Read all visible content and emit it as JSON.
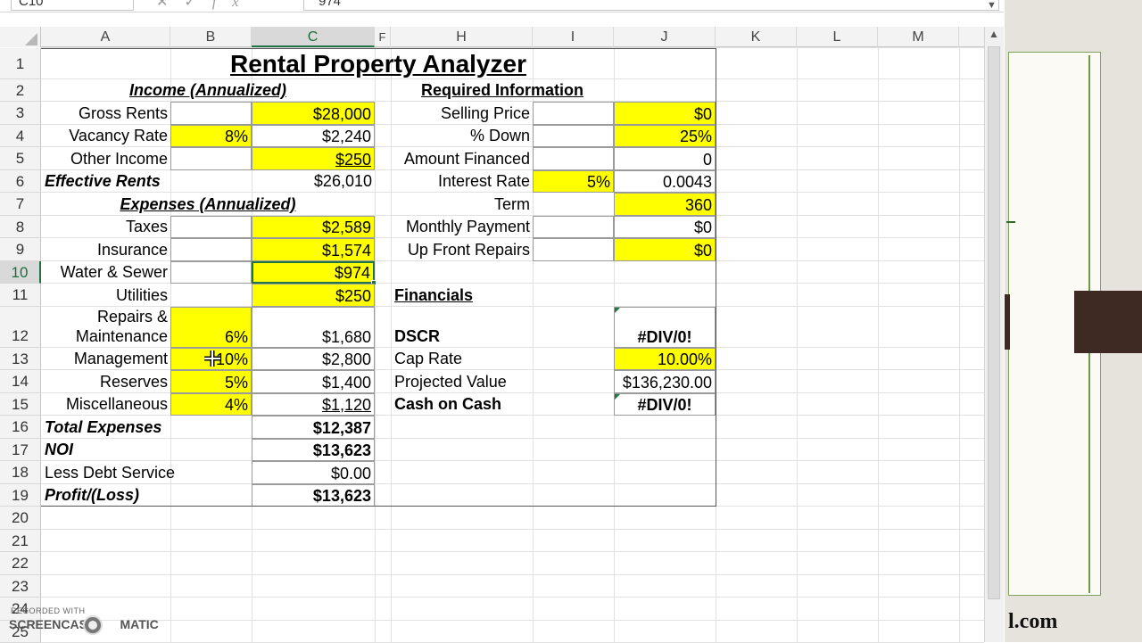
{
  "formula_bar": {
    "name_box": "C10",
    "icons": [
      "cancel-icon",
      "enter-icon",
      "function-icon"
    ],
    "formula": "974"
  },
  "columns": [
    "A",
    "B",
    "C",
    "F",
    "H",
    "I",
    "J",
    "K",
    "L",
    "M"
  ],
  "selected_column": "C",
  "rows": [
    "1",
    "2",
    "3",
    "4",
    "5",
    "6",
    "7",
    "8",
    "9",
    "10",
    "11",
    "12",
    "13",
    "14",
    "15",
    "16",
    "17",
    "18",
    "19",
    "20",
    "21",
    "22",
    "23",
    "24",
    "25"
  ],
  "selected_row": "10",
  "sheet": {
    "title": "Rental Property Analyzer",
    "income_header": "Income (Annualized)",
    "required_header": "Required Information",
    "gross_rents": {
      "label": "Gross Rents",
      "value": "$28,000"
    },
    "vacancy_rate": {
      "label": "Vacancy Rate",
      "pct": "8%",
      "value": "$2,240"
    },
    "other_income": {
      "label": "Other Income",
      "value": "$250"
    },
    "effective_rents": {
      "label": "Effective Rents",
      "value": "$26,010"
    },
    "expenses_header": "Expenses (Annualized)",
    "taxes": {
      "label": "Taxes",
      "value": "$2,589"
    },
    "insurance": {
      "label": "Insurance",
      "value": "$1,574"
    },
    "water_sewer": {
      "label": "Water & Sewer",
      "value": "$974"
    },
    "utilities": {
      "label": "Utilities",
      "value": "$250"
    },
    "repairs": {
      "label_line1": "Repairs &",
      "label_line2": "Maintenance",
      "pct": "6%",
      "value": "$1,680"
    },
    "management": {
      "label": "Management",
      "pct": "10%",
      "value": "$2,800"
    },
    "reserves": {
      "label": "Reserves",
      "pct": "5%",
      "value": "$1,400"
    },
    "miscellaneous": {
      "label": "Miscellaneous",
      "pct": "4%",
      "value": "$1,120"
    },
    "total_expenses": {
      "label": "Total Expenses",
      "value": "$12,387"
    },
    "noi": {
      "label": "NOI",
      "value": "$13,623"
    },
    "less_debt_service": {
      "label": "Less Debt Service",
      "value": "$0.00"
    },
    "profit_loss": {
      "label": "Profit/(Loss)",
      "value": "$13,623"
    },
    "selling_price": {
      "label": "Selling Price",
      "value": "$0"
    },
    "pct_down": {
      "label": "% Down",
      "value": "25%"
    },
    "amount_financed": {
      "label": "Amount Financed",
      "value": "0"
    },
    "interest_rate": {
      "label": "Interest Rate",
      "pct": "5%",
      "value": "0.0043"
    },
    "term": {
      "label": "Term",
      "value": "360"
    },
    "monthly_payment": {
      "label": "Monthly Payment",
      "value": "$0"
    },
    "up_front_repairs": {
      "label": "Up Front Repairs",
      "value": "$0"
    },
    "financials_header": "Financials",
    "dscr": {
      "label": "DSCR",
      "value": "#DIV/0!"
    },
    "cap_rate": {
      "label": "Cap Rate",
      "value": "10.00%"
    },
    "projected_value": {
      "label": "Projected Value",
      "value": "$136,230.00"
    },
    "cash_on_cash": {
      "label": "Cash on Cash",
      "value": "#DIV/0!"
    }
  },
  "background_window": {
    "text": "l.com"
  },
  "watermark": {
    "small": "RECORDED WITH",
    "logo_left": "SCREENCAST",
    "logo_right": "MATIC"
  },
  "colors": {
    "highlight": "#ffff00",
    "selection": "#217346",
    "header_bg": "#f3f3f3"
  }
}
